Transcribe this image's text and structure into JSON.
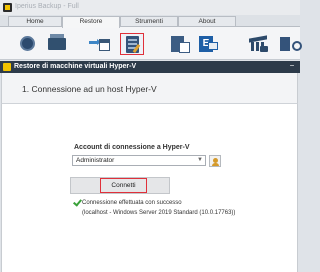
{
  "app": {
    "title": "Iperius Backup - Full"
  },
  "tabs": [
    {
      "label": "Home"
    },
    {
      "label": "Restore"
    },
    {
      "label": "Strumenti"
    },
    {
      "label": "About"
    }
  ],
  "ribbon": {
    "icons": [
      "disk-restore-icon",
      "drive-image-icon",
      "file-restore-icon",
      "hyper-v-restore-icon",
      "server-edit-icon",
      "exchange-restore-icon",
      "database-restore-icon",
      "network-restore-icon"
    ],
    "selected": "hyper-v-restore-icon"
  },
  "dialog": {
    "title": "Restore di macchine virtuali Hyper-V",
    "minimize_glyph": "−",
    "step_title": "1. Connessione ad un host Hyper-V",
    "account_label": "Account di connessione a Hyper-V",
    "account_value": "Administrator",
    "account_caret": "▼",
    "connect_label": "Connetti",
    "status_text": "Connessione effettuata con successo",
    "status_detail": "(localhost - Windows Server 2019 Standard (10.0.17763))"
  },
  "colors": {
    "accent_highlight": "#e0303a",
    "dialog_title_bg": "#2d3b4a",
    "success_green": "#3aa13a",
    "logo_yellow": "#f2c300"
  }
}
